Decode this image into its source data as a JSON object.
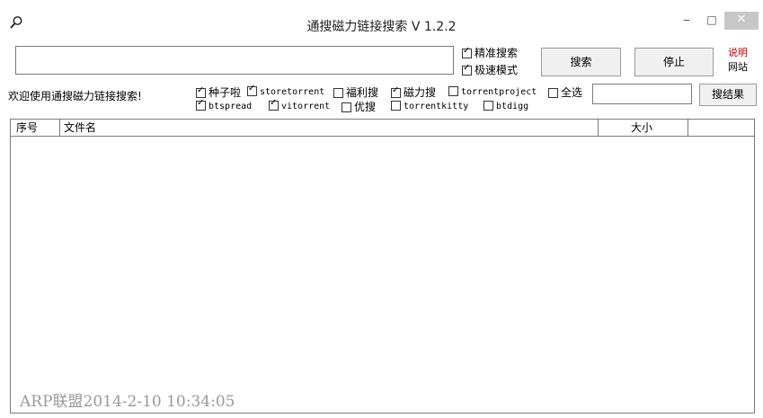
{
  "window": {
    "title": "通搜磁力链接搜索 V 1.2.2",
    "icon": "search-icon",
    "min_glyph": "‒",
    "max_glyph": "□",
    "close_glyph": "✕"
  },
  "search": {
    "value": "",
    "placeholder": ""
  },
  "mode_options": [
    {
      "label": "精准搜索",
      "checked": true
    },
    {
      "label": "极速模式",
      "checked": true
    }
  ],
  "buttons": {
    "search": "搜索",
    "stop": "停止",
    "search_results": "搜结果"
  },
  "links": {
    "help": "说明",
    "site": "网站"
  },
  "welcome": "欢迎使用通搜磁力链接搜索!",
  "sources_row1": [
    {
      "label": "种子啦",
      "checked": true
    },
    {
      "label": "storetorrent",
      "checked": true
    },
    {
      "label": "福利搜",
      "checked": false
    },
    {
      "label": "磁力搜",
      "checked": true
    },
    {
      "label": "torrentproject",
      "checked": false
    },
    {
      "label": "全选",
      "checked": false
    }
  ],
  "sources_row2": [
    {
      "label": "btspread",
      "checked": true
    },
    {
      "label": "vitorrent",
      "checked": true
    },
    {
      "label": "优搜",
      "checked": false
    },
    {
      "label": "torrentkitty",
      "checked": false
    },
    {
      "label": "btdigg",
      "checked": false
    }
  ],
  "table": {
    "columns": [
      "序号",
      "文件名",
      "大小",
      ""
    ],
    "rows": []
  },
  "watermark": "ARP联盟2014-2-10 10:34:05",
  "colors": {
    "help_link": "#c00000",
    "close_button": "#c7c7c7",
    "watermark": "#9a9a9a"
  }
}
